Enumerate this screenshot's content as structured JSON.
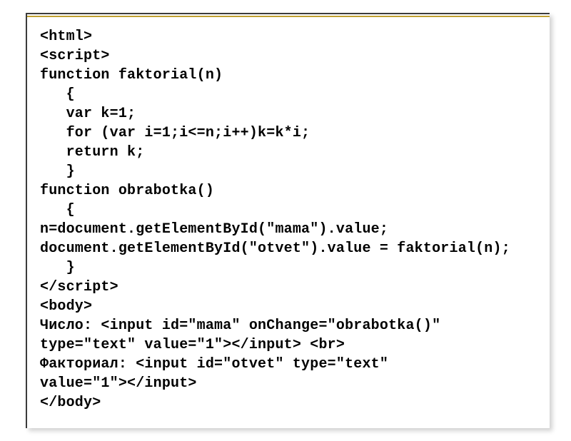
{
  "code": {
    "lines": [
      "<html>",
      "<script>",
      "function faktorial(n)",
      "   {",
      "   var k=1;",
      "   for (var i=1;i<=n;i++)k=k*i;",
      "   return k;",
      "   }",
      "function obrabotka()",
      "   {",
      "n=document.getElementById(\"mama\").value;",
      "document.getElementById(\"otvet\").value = faktorial(n);",
      "   }",
      "</script>",
      "<body>",
      "Число: <input id=\"mama\" onChange=\"obrabotka()\"",
      "type=\"text\" value=\"1\"></input> <br>",
      "Факториал: <input id=\"otvet\" type=\"text\"",
      "value=\"1\"></input>",
      "</body>"
    ]
  }
}
